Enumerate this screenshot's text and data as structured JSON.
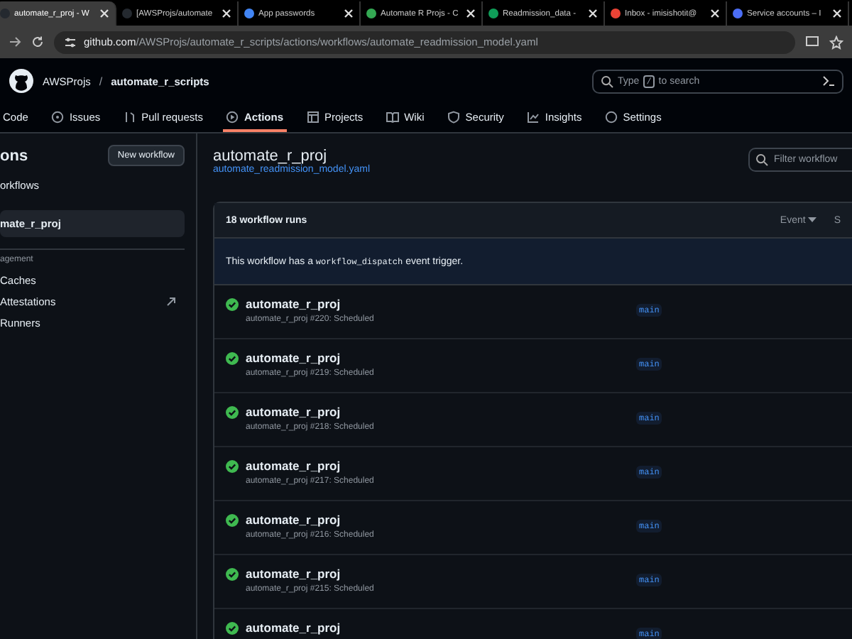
{
  "browser": {
    "tabs": [
      {
        "title": "automate_r_proj - W",
        "selected": true
      },
      {
        "title": "[AWSProjs/automate",
        "selected": false
      },
      {
        "title": "App passwords",
        "selected": false
      },
      {
        "title": "Automate R Projs - C",
        "selected": false
      },
      {
        "title": "Readmission_data -",
        "selected": false
      },
      {
        "title": "Inbox - imisishotit@",
        "selected": false
      },
      {
        "title": "Service accounts – I",
        "selected": false
      }
    ],
    "url_host": "github.com",
    "url_path": "/AWSProjs/automate_r_scripts/actions/workflows/automate_readmission_model.yaml"
  },
  "header": {
    "owner": "AWSProjs",
    "separator": "/",
    "repo": "automate_r_scripts",
    "search_placeholder_before": "Type",
    "search_key": "/",
    "search_placeholder_after": "to search"
  },
  "nav": [
    {
      "label": "Code",
      "selected": false
    },
    {
      "label": "Issues",
      "selected": false
    },
    {
      "label": "Pull requests",
      "selected": false
    },
    {
      "label": "Actions",
      "selected": true
    },
    {
      "label": "Projects",
      "selected": false
    },
    {
      "label": "Wiki",
      "selected": false
    },
    {
      "label": "Security",
      "selected": false
    },
    {
      "label": "Insights",
      "selected": false
    },
    {
      "label": "Settings",
      "selected": false
    }
  ],
  "sidebar": {
    "title": "ons",
    "new_button": "New workflow",
    "items": [
      {
        "label": "orkflows",
        "selected": false
      },
      {
        "label": "mate_r_proj",
        "selected": true
      }
    ],
    "section": "agement",
    "section_items": [
      {
        "label": "Caches",
        "external": false
      },
      {
        "label": "Attestations",
        "external": true
      },
      {
        "label": "Runners",
        "external": false
      }
    ]
  },
  "main": {
    "title": "automate_r_proj",
    "file_link": "automate_readmission_model.yaml",
    "filter_placeholder": "Filter workflow",
    "runs_count": "18 workflow runs",
    "filters": [
      "Event",
      "S"
    ],
    "notice_before": "This workflow has a",
    "notice_code": "workflow_dispatch",
    "notice_after": "event trigger.",
    "runs": [
      {
        "title": "automate_r_proj",
        "subtitle": "automate_r_proj #220: Scheduled",
        "branch": "main"
      },
      {
        "title": "automate_r_proj",
        "subtitle": "automate_r_proj #219: Scheduled",
        "branch": "main"
      },
      {
        "title": "automate_r_proj",
        "subtitle": "automate_r_proj #218: Scheduled",
        "branch": "main"
      },
      {
        "title": "automate_r_proj",
        "subtitle": "automate_r_proj #217: Scheduled",
        "branch": "main"
      },
      {
        "title": "automate_r_proj",
        "subtitle": "automate_r_proj #216: Scheduled",
        "branch": "main"
      },
      {
        "title": "automate_r_proj",
        "subtitle": "automate_r_proj #215: Scheduled",
        "branch": "main"
      },
      {
        "title": "automate_r_proj",
        "branch": "main"
      }
    ]
  }
}
